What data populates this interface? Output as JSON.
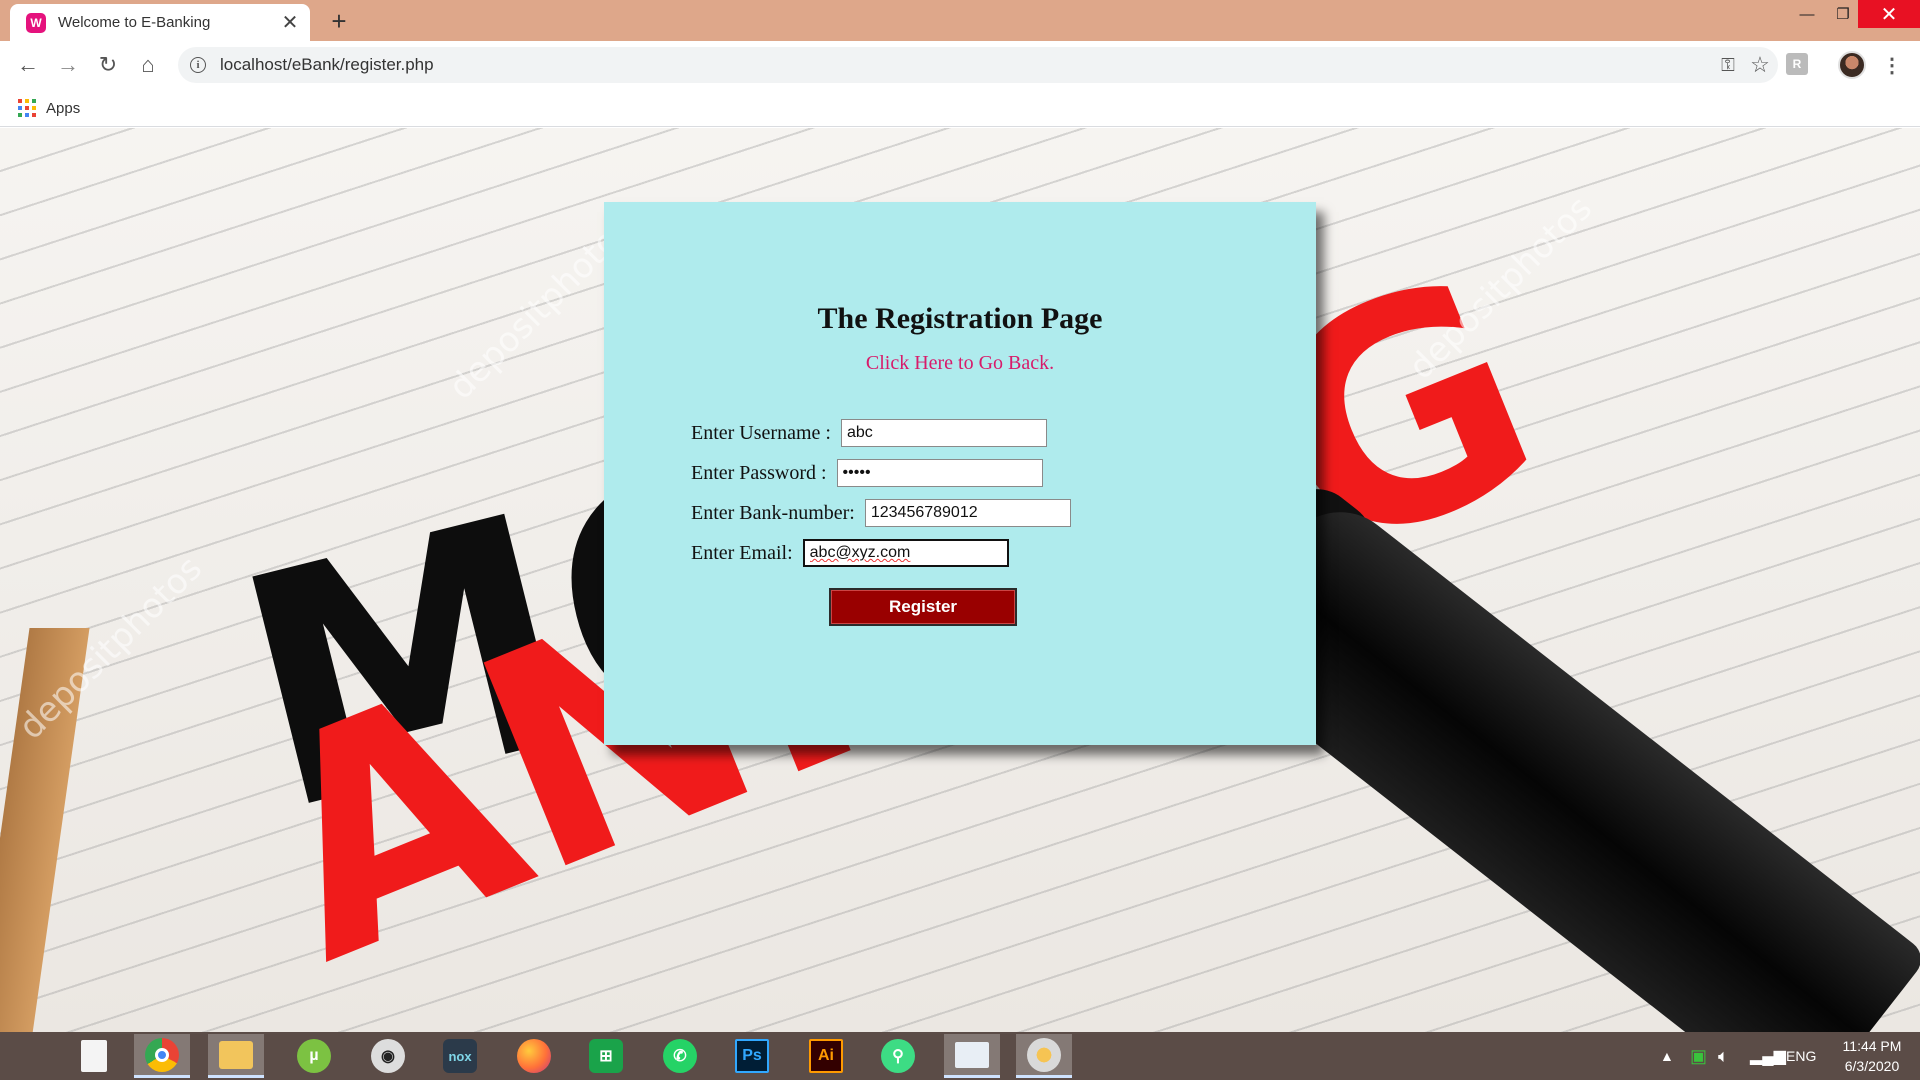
{
  "browser": {
    "tab_title": "Welcome to E-Banking",
    "tab_close": "✕",
    "new_tab": "+",
    "url": "localhost/eBank/register.php",
    "bookmarks": {
      "apps_label": "Apps"
    },
    "window_controls": {
      "minimize": "—",
      "maximize": "❐",
      "close": "✕"
    }
  },
  "page": {
    "background_art": {
      "word_black": "MO",
      "word_red": "ANKING",
      "watermark": "depositphotos"
    },
    "title": "The Registration Page",
    "back_link": "Click Here to Go Back.",
    "form": {
      "username_label": "Enter Username :",
      "username_value": "abc",
      "password_label": "Enter Password :",
      "password_value": "•••••",
      "bank_label": "Enter Bank-number:",
      "bank_value": "123456789012",
      "email_label": "Enter Email:",
      "email_value": "abc@xyz.com",
      "register_label": "Register"
    },
    "colors": {
      "card_bg": "#afebed",
      "button_bg": "#990000",
      "link": "#d81b6a"
    }
  },
  "taskbar": {
    "apps": [
      "start-icon",
      "file-icon",
      "chrome-icon",
      "file-explorer-icon",
      "utorrent-icon",
      "speaker-app-icon",
      "nox-icon",
      "firefox-icon",
      "store-icon",
      "whatsapp-icon",
      "photoshop-icon",
      "illustrator-icon",
      "android-studio-icon",
      "monitor-app-icon",
      "paint-icon"
    ],
    "nox_label": "nox",
    "ps_label": "Ps",
    "ai_label": "Ai",
    "language": "ENG",
    "time": "11:44 PM",
    "date": "6/3/2020"
  }
}
